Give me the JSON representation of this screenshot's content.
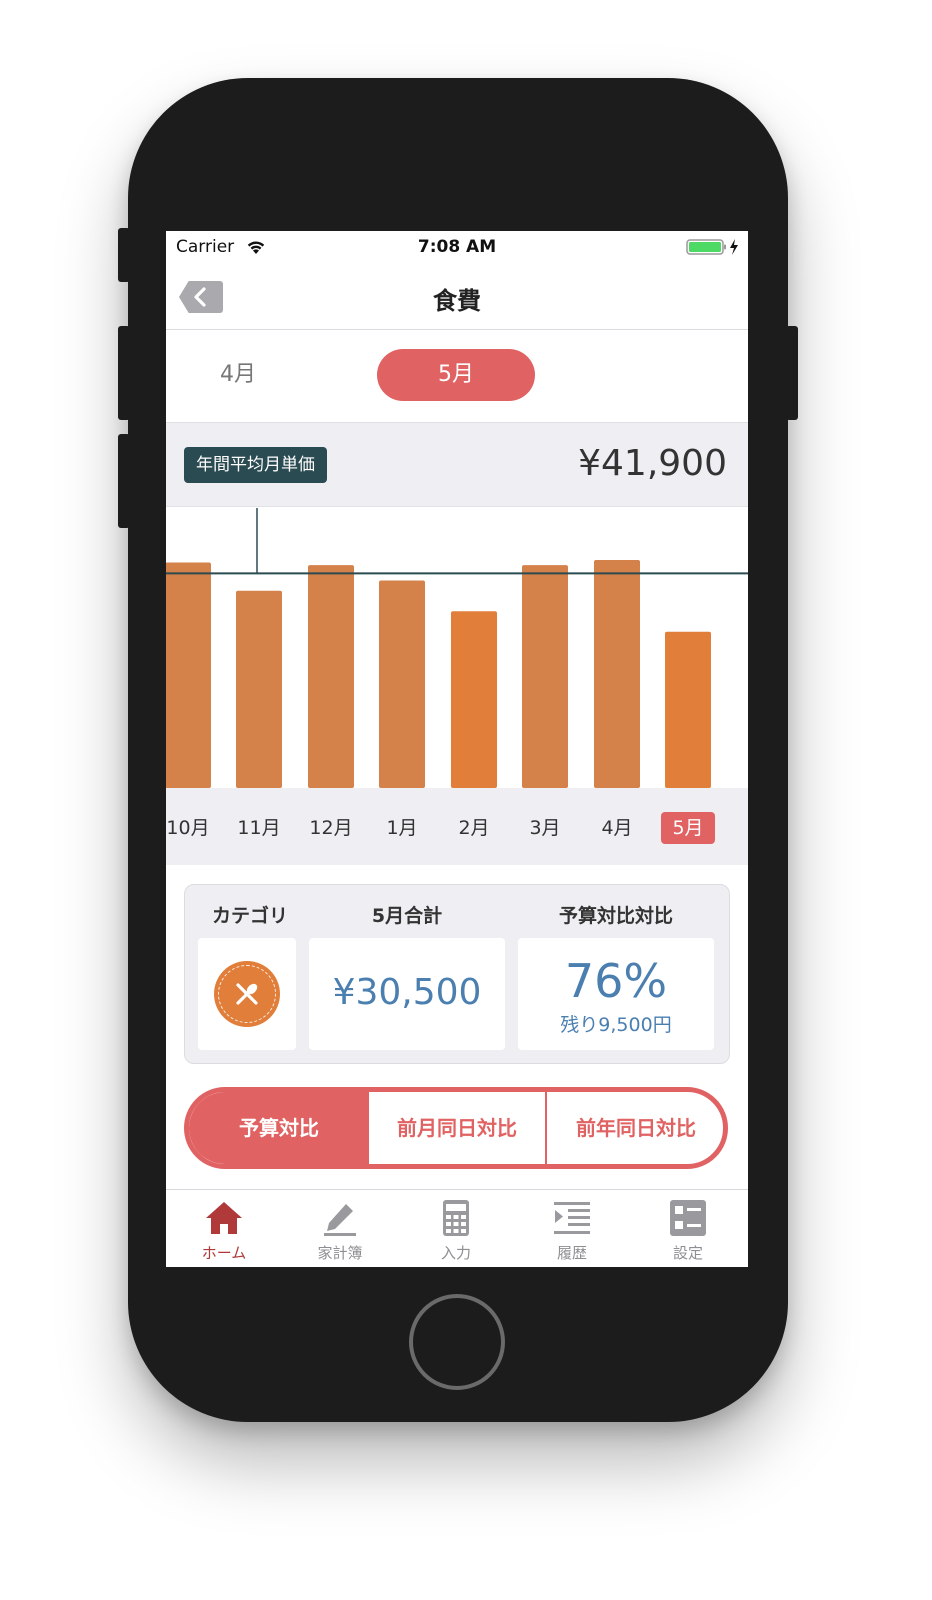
{
  "status_bar": {
    "carrier": "Carrier",
    "time": "7:08 AM"
  },
  "nav": {
    "title": "食費",
    "back_icon": "chevron-left-icon"
  },
  "month_tabs": [
    {
      "label": "4月",
      "selected": false
    },
    {
      "label": "5月",
      "selected": true
    }
  ],
  "average": {
    "label": "年間平均月単価",
    "value": "¥41,900"
  },
  "chart_data": {
    "type": "bar",
    "categories": [
      "10月",
      "11月",
      "12月",
      "1月",
      "2月",
      "3月",
      "4月",
      "5月"
    ],
    "values": [
      44000,
      38500,
      43500,
      40500,
      34500,
      43500,
      44500,
      30500
    ],
    "reference_line": 41900,
    "highlight_category": "5月",
    "colors": {
      "bar": "#d4814a",
      "bar_alt": "#e07e3a",
      "reference_line": "#2a4b52"
    }
  },
  "summary": {
    "category_header": "カテゴリ",
    "total_header": "5月合計",
    "ratio_header": "予算対比対比",
    "category_icon": "fork-spoon-icon",
    "total_value": "¥30,500",
    "ratio_value": "76%",
    "remaining": "残り9,500円"
  },
  "segments": [
    {
      "label": "予算対比",
      "selected": true
    },
    {
      "label": "前月同日対比",
      "selected": false
    },
    {
      "label": "前年同日対比",
      "selected": false
    }
  ],
  "tab_bar": [
    {
      "label": "ホーム",
      "icon": "home-icon",
      "active": true
    },
    {
      "label": "家計簿",
      "icon": "pencil-icon",
      "active": false
    },
    {
      "label": "入力",
      "icon": "calculator-icon",
      "active": false
    },
    {
      "label": "履歴",
      "icon": "list-icon",
      "active": false
    },
    {
      "label": "設定",
      "icon": "settings-grid-icon",
      "active": false
    }
  ],
  "colors": {
    "accent": "#e06262",
    "value_blue": "#4a7fb0",
    "dark_teal": "#2a4b52"
  }
}
